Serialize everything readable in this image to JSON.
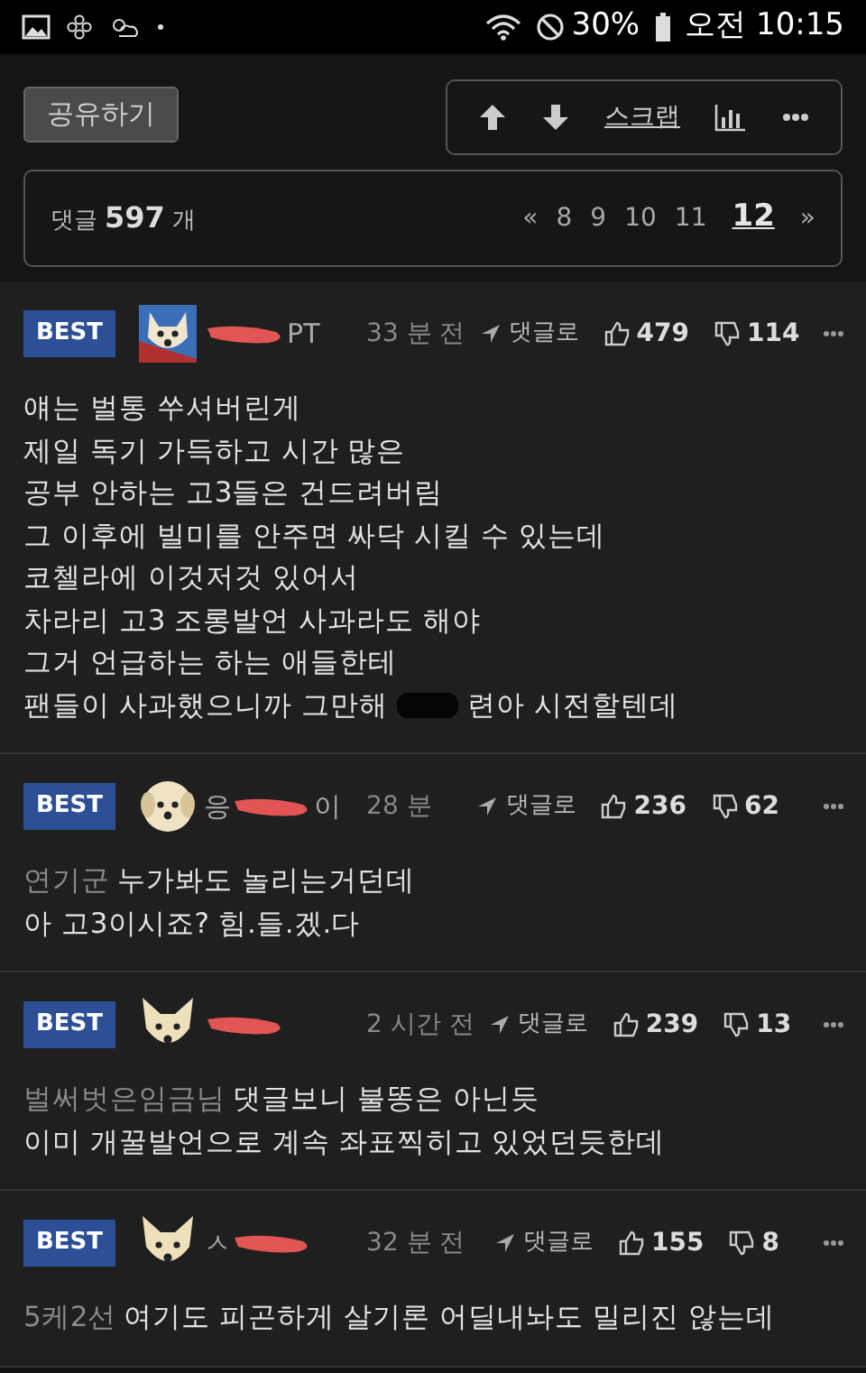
{
  "status_bar": {
    "battery": "30%",
    "time": "오전 10:15"
  },
  "toolbar": {
    "share_button": "공유하기",
    "actions": [
      {
        "kind": "up"
      },
      {
        "kind": "down"
      },
      {
        "kind": "text",
        "label": "스크랩"
      },
      {
        "kind": "stats"
      },
      {
        "kind": "more"
      }
    ]
  },
  "comment_summary": {
    "label": "댓글",
    "count": "597",
    "unit": "개",
    "pages": [
      {
        "label": "«",
        "selected": false
      },
      {
        "label": "8",
        "selected": false
      },
      {
        "label": "9",
        "selected": false
      },
      {
        "label": "10",
        "selected": false
      },
      {
        "label": "11",
        "selected": false
      },
      {
        "label": "12",
        "selected": true
      },
      {
        "label": "»",
        "selected": false
      }
    ]
  },
  "comments": [
    {
      "badge": "BEST",
      "avatar": {
        "kind": "photo"
      },
      "name_parts": [
        {
          "kind": "scribble"
        },
        {
          "kind": "text",
          "text": "PT"
        }
      ],
      "time": "33 분 전",
      "reply_label": "댓글로",
      "likes": "479",
      "dislikes": "114",
      "lines": [
        {
          "kind": "plain",
          "text": "얘는 벌통 쑤셔버린게"
        },
        {
          "kind": "plain",
          "text": "제일 독기 가득하고 시간 많은"
        },
        {
          "kind": "plain",
          "text": "공부 안하는 고3들은 건드려버림"
        },
        {
          "kind": "plain",
          "text": "그 이후에 빌미를 안주면 싸닥 시킬 수 있는데"
        },
        {
          "kind": "plain",
          "text": "코첼라에 이것저것 있어서"
        },
        {
          "kind": "plain",
          "text": "차라리 고3 조롱발언 사과라도 해야"
        },
        {
          "kind": "plain",
          "text": "그거 언급하는 하는 애들한테"
        },
        {
          "kind": "censored",
          "before": "팬들이 사과했으니까 그만해",
          "after": "련아 시전할텐데"
        }
      ]
    },
    {
      "badge": "BEST",
      "avatar": {
        "kind": "puppy"
      },
      "name_parts": [
        {
          "kind": "text",
          "text": "응"
        },
        {
          "kind": "scribble"
        },
        {
          "kind": "text",
          "text": "이"
        }
      ],
      "time": "28 분",
      "reply_label": "댓글로",
      "likes": "236",
      "dislikes": "62",
      "mention": "연기군",
      "lines": [
        {
          "kind": "plain",
          "text": "누가봐도 놀리는거던데"
        },
        {
          "kind": "plain",
          "text": "아 고3이시죠? 힘.들.겠.다"
        }
      ]
    },
    {
      "badge": "BEST",
      "avatar": {
        "kind": "chihuahua"
      },
      "name_parts": [
        {
          "kind": "scribble"
        }
      ],
      "time": "2 시간 전",
      "reply_label": "댓글로",
      "likes": "239",
      "dislikes": "13",
      "mention": "벌써벗은임금님",
      "lines": [
        {
          "kind": "plain",
          "text": "댓글보니 불똥은 아닌듯"
        },
        {
          "kind": "plain",
          "text": "이미 개꿀발언으로 계속 좌표찍히고 있었던듯한데"
        }
      ]
    },
    {
      "badge": "BEST",
      "avatar": {
        "kind": "chihuahua"
      },
      "name_parts": [
        {
          "kind": "text",
          "text": "ㅅ"
        },
        {
          "kind": "scribble"
        }
      ],
      "time": "32 분 전",
      "reply_label": "댓글로",
      "likes": "155",
      "dislikes": "8",
      "mention": "5케2선",
      "lines": [
        {
          "kind": "plain",
          "text": "여기도 피곤하게 살기론 어딜내놔도 밀리진 않는데"
        }
      ]
    }
  ]
}
